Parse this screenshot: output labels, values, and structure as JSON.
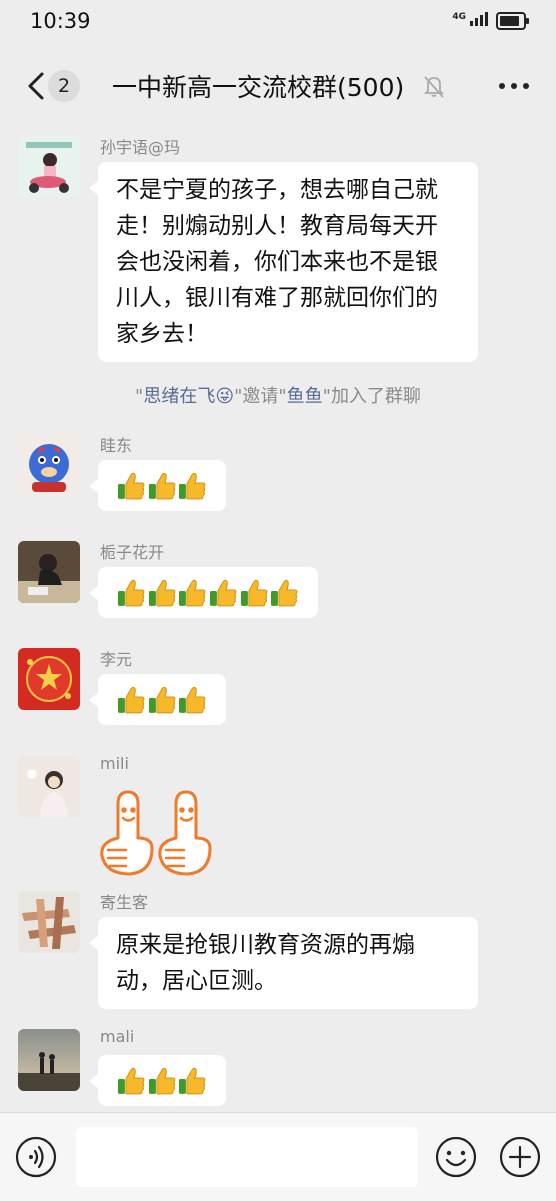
{
  "status_bar": {
    "time": "10:39",
    "network": "4G",
    "battery_pct": 85
  },
  "header": {
    "back_count": "2",
    "title": "一中新高一交流校群(500)",
    "muted": true
  },
  "messages": [
    {
      "sender": "孙宇语@玛",
      "text": "不是宁夏的孩子，想去哪自己就走！别煽动别人！教育局每天开会也没闲着，你们本来也不是银川人，银川有难了那就回你们的家乡去！",
      "avatar": "girl-on-scooter-avatar"
    },
    {
      "sender": "眭东",
      "thumbs_up_count": 3,
      "avatar": "tiger-avatar"
    },
    {
      "sender": "栀子花开",
      "thumbs_up_count": 6,
      "avatar": "person-writing-avatar"
    },
    {
      "sender": "李元",
      "thumbs_up_count": 3,
      "avatar": "red-star-avatar"
    },
    {
      "sender": "mili",
      "sticker": "thumbs-up-sticker",
      "avatar": "girl-avatar"
    },
    {
      "sender": "寄生客",
      "text": "原来是抢银川教育资源的再煽动，居心叵测。",
      "avatar": "hands-avatar"
    },
    {
      "sender": "mali",
      "thumbs_up_count": 3,
      "avatar": "sunset-couple-avatar"
    }
  ],
  "system_notice": {
    "q1": "\"",
    "inviter": "思绪在飞😜",
    "q2": "\"",
    "mid": "邀请",
    "q3": "\"",
    "invitee": "鱼鱼",
    "q4": "\"",
    "suffix": "加入了群聊"
  },
  "composer": {
    "input_value": "",
    "icons": [
      "voice-icon",
      "emoji-icon",
      "plus-icon"
    ]
  }
}
